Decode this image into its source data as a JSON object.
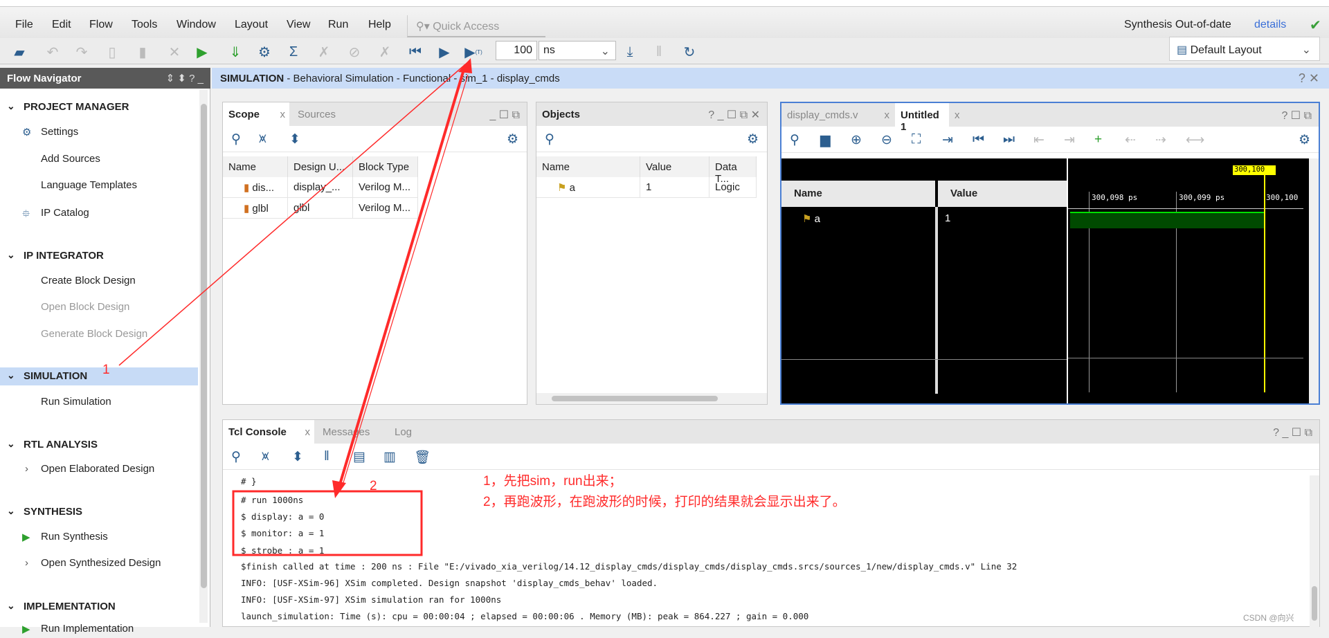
{
  "menubar": {
    "items": [
      "File",
      "Edit",
      "Flow",
      "Tools",
      "Window",
      "Layout",
      "View",
      "Run",
      "Help"
    ],
    "quick_access": "Quick Access",
    "status": "Synthesis Out-of-date",
    "details": "details"
  },
  "toolbar": {
    "run_time": "100",
    "run_unit": "ns",
    "layout": "Default Layout"
  },
  "flow_navigator": {
    "title": "Flow Navigator",
    "items": [
      {
        "label": "PROJECT MANAGER",
        "type": "section"
      },
      {
        "label": "Settings",
        "type": "item"
      },
      {
        "label": "Add Sources",
        "type": "item"
      },
      {
        "label": "Language Templates",
        "type": "item"
      },
      {
        "label": "IP Catalog",
        "type": "item"
      },
      {
        "label": "IP INTEGRATOR",
        "type": "section"
      },
      {
        "label": "Create Block Design",
        "type": "item"
      },
      {
        "label": "Open Block Design",
        "type": "grey"
      },
      {
        "label": "Generate Block Design",
        "type": "grey"
      },
      {
        "label": "SIMULATION",
        "type": "section-selected"
      },
      {
        "label": "Run Simulation",
        "type": "item"
      },
      {
        "label": "RTL ANALYSIS",
        "type": "section"
      },
      {
        "label": "Open Elaborated Design",
        "type": "item"
      },
      {
        "label": "SYNTHESIS",
        "type": "section"
      },
      {
        "label": "Run Synthesis",
        "type": "item"
      },
      {
        "label": "Open Synthesized Design",
        "type": "item"
      },
      {
        "label": "IMPLEMENTATION",
        "type": "section"
      },
      {
        "label": "Run Implementation",
        "type": "item"
      }
    ]
  },
  "main_header": {
    "bold": "SIMULATION",
    "rest": " - Behavioral Simulation - Functional - sim_1 - display_cmds"
  },
  "scope": {
    "tabs": [
      "Scope",
      "Sources"
    ],
    "columns": [
      "Name",
      "Design U...",
      "Block Type"
    ],
    "rows": [
      [
        "dis...",
        "display_...",
        "Verilog M..."
      ],
      [
        "glbl",
        "glbl",
        "Verilog M..."
      ]
    ]
  },
  "objects": {
    "title": "Objects",
    "columns": [
      "Name",
      "Value",
      "Data T..."
    ],
    "rows": [
      [
        "a",
        "1",
        "Logic"
      ]
    ]
  },
  "wave": {
    "tabs": [
      "display_cmds.v",
      "Untitled 1"
    ],
    "columns": [
      "Name",
      "Value"
    ],
    "signals": [
      {
        "name": "a",
        "value": "1"
      }
    ],
    "cursor": "300,100 ps",
    "ticks": [
      "300,098 ps",
      "300,099 ps",
      "300,100"
    ],
    "wave_color": "#00a000",
    "cursor_color": "#ffff00"
  },
  "console": {
    "tabs": [
      "Tcl Console",
      "Messages",
      "Log"
    ],
    "lines": [
      "# }",
      "# run 1000ns",
      "$ display: a = 0",
      "$ monitor: a = 1",
      "$ strobe : a = 1",
      "$finish called at time : 200 ns : File \"E:/vivado_xia_verilog/14.12_display_cmds/display_cmds/display_cmds.srcs/sources_1/new/display_cmds.v\" Line 32",
      "INFO: [USF-XSim-96] XSim completed. Design snapshot 'display_cmds_behav' loaded.",
      "INFO: [USF-XSim-97] XSim simulation ran for 1000ns",
      "launch_simulation: Time (s): cpu = 00:00:04 ; elapsed = 00:00:06 . Memory (MB): peak = 864.227 ; gain = 0.000"
    ]
  },
  "annotations": {
    "label1": "1",
    "label2": "2",
    "note1": "1，先把sim，run出来；",
    "note2": "2，再跑波形，在跑波形的时候，打印的结果就会显示出来了。",
    "color": "#ff2a2a"
  },
  "watermark": "CSDN @向兴"
}
